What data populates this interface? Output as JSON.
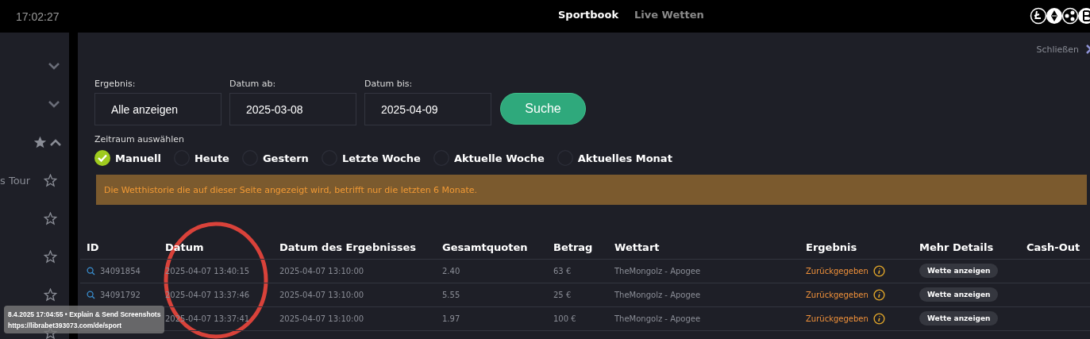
{
  "top_bar": {
    "time": "17:02:27",
    "nav": [
      {
        "label": "Sportbook",
        "selected": true
      },
      {
        "label": "Live Wetten",
        "selected": false
      }
    ]
  },
  "sidebar": {
    "items": [
      {
        "kind": "collapsed"
      },
      {
        "kind": "collapsed"
      },
      {
        "kind": "favorites"
      },
      {
        "kind": "event",
        "label": "s Tour"
      },
      {
        "kind": "event"
      },
      {
        "kind": "event"
      },
      {
        "kind": "event"
      },
      {
        "kind": "event"
      }
    ]
  },
  "panel": {
    "close": "Schließen",
    "filters": [
      {
        "label": "Ergebnis:",
        "value": "Alle anzeigen"
      },
      {
        "label": "Datum ab:",
        "value": "2025-03-08"
      },
      {
        "label": "Datum bis:",
        "value": "2025-04-09"
      }
    ],
    "search_button": "Suche",
    "period": {
      "label": "Zeitraum auswählen",
      "options": [
        {
          "label": "Manuell",
          "selected": true
        },
        {
          "label": "Heute",
          "selected": false
        },
        {
          "label": "Gestern",
          "selected": false
        },
        {
          "label": "Letzte Woche",
          "selected": false
        },
        {
          "label": "Aktuelle Woche",
          "selected": false
        },
        {
          "label": "Aktuelles Monat",
          "selected": false
        }
      ]
    },
    "notice": "Die Wetthistorie die auf dieser Seite angezeigt wird, betrifft nur die letzten 6 Monate.",
    "table": {
      "columns": [
        "ID",
        "Datum",
        "Datum des Ergebnisses",
        "Gesamtquoten",
        "Betrag",
        "Wettart",
        "Ergebnis",
        "Mehr Details",
        "Cash-Out"
      ],
      "rows": [
        {
          "id": "34091854",
          "date": "2025-04-07 13:40:15",
          "result_date": "2025-04-07 13:10:00",
          "odds": "2.40",
          "stake": "63 €",
          "bet_type": "TheMongolz - Apogee",
          "result": "Zurückgegeben",
          "details": "Wette anzeigen"
        },
        {
          "id": "34091792",
          "date": "2025-04-07 13:37:46",
          "result_date": "2025-04-07 13:10:00",
          "odds": "5.55",
          "stake": "25 €",
          "bet_type": "TheMongolz - Apogee",
          "result": "Zurückgegeben",
          "details": "Wette anzeigen"
        },
        {
          "date": "2025-04-07 13:37:41",
          "result_date": "2025-04-07 13:10:00",
          "odds": "1.97",
          "stake": "100 €",
          "bet_type": "TheMongolz - Apogee",
          "result": "Zurückgegeben",
          "details": "Wette anzeigen"
        }
      ]
    }
  },
  "capture_overlay": {
    "line_1": "8.4.2025 17:04:55 • Explain & Send Screenshots",
    "line_2": "https://librabet393073.com/de/sport"
  }
}
